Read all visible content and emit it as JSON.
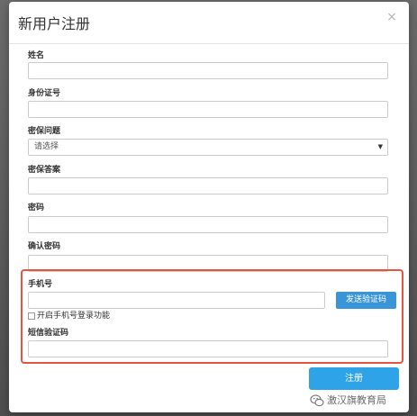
{
  "modal": {
    "title": "新用户注册",
    "close_glyph": "×"
  },
  "form": {
    "name_label": "姓名",
    "name_value": "",
    "id_label": "身份证号",
    "id_value": "",
    "question_label": "密保问题",
    "question_selected": "请选择",
    "answer_label": "密保答案",
    "answer_value": "",
    "password_label": "密码",
    "password_value": "",
    "confirm_label": "确认密码",
    "confirm_value": "",
    "phone_label": "手机号",
    "phone_value": "",
    "send_code_label": "发送验证码",
    "enable_phone_login_label": "开启手机号登录功能",
    "enable_phone_login_checked": false,
    "sms_label": "短信验证码",
    "sms_value": "",
    "register_label": "注册"
  },
  "watermark": {
    "text": "激汉旗教育局",
    "icon": "wechat-icon"
  },
  "colors": {
    "accent": "#2ea3e8",
    "send_button": "#3a95d8",
    "highlight": "#e8533e"
  }
}
